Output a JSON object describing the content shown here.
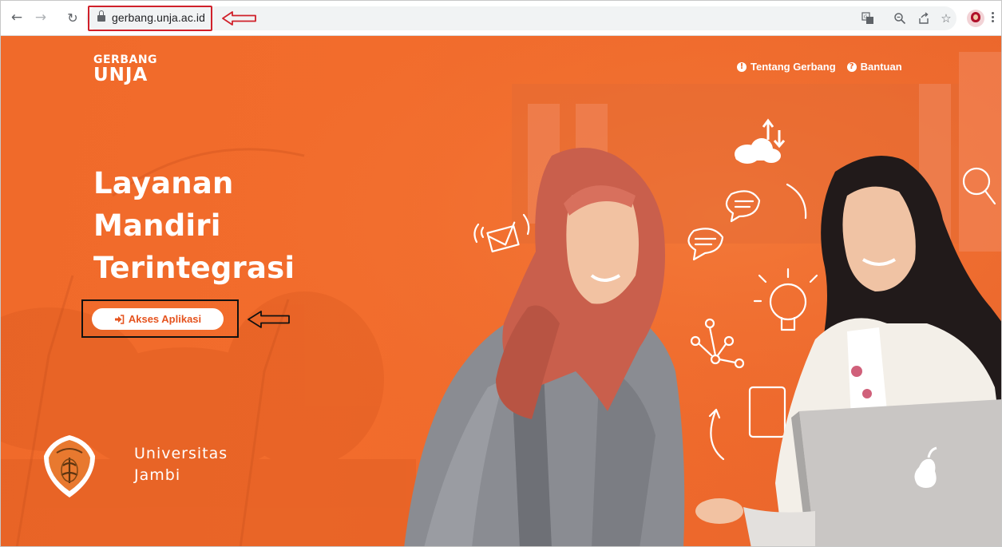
{
  "browser": {
    "url": "gerbang.unja.ac.id",
    "icons": {
      "back": "back-arrow-icon",
      "forward": "forward-arrow-icon",
      "reload": "reload-icon",
      "lock": "lock-icon",
      "translate": "translate-icon",
      "zoom": "zoom-icon",
      "share": "share-icon",
      "bookmark": "star-icon",
      "menu": "kebab-menu-icon"
    },
    "annotation_color": "#d0202a"
  },
  "site": {
    "logo": {
      "line1": "GERBANG",
      "line2": "UNJA"
    },
    "nav": [
      {
        "label": "Tentang Gerbang",
        "icon": "exclamation-circle-icon",
        "glyph": "!"
      },
      {
        "label": "Bantuan",
        "icon": "question-circle-icon",
        "glyph": "?"
      }
    ],
    "headline": [
      "Layanan",
      "Mandiri",
      "Terintegrasi"
    ],
    "cta": {
      "label": "Akses Aplikasi",
      "icon": "sign-in-icon"
    },
    "university": {
      "line1": "Universitas",
      "line2": "Jambi"
    },
    "colors": {
      "brand_orange": "#f06a2a",
      "cta_text": "#e5531e",
      "white": "#ffffff"
    }
  }
}
